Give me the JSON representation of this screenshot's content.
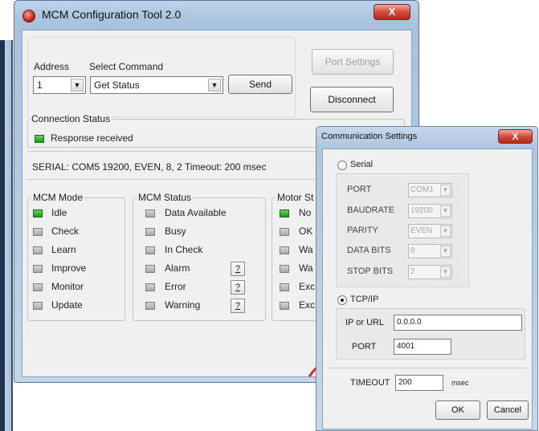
{
  "window": {
    "title": "MCM Configuration Tool 2.0",
    "close_label": "X"
  },
  "top": {
    "address_label": "Address",
    "select_command_label": "Select Command",
    "address_value": "1",
    "command_value": "Get Status",
    "send_label": "Send",
    "port_settings_label": "Port Settings",
    "disconnect_label": "Disconnect"
  },
  "connection": {
    "group_title": "Connection Status",
    "response_text": "Response received",
    "serial_info": "SERIAL: COM5  19200, EVEN, 8, 2 Timeout: 200 msec"
  },
  "mcm_mode": {
    "title": "MCM Mode",
    "items": [
      {
        "label": "Idle",
        "on": true
      },
      {
        "label": "Check",
        "on": false
      },
      {
        "label": "Learn",
        "on": false
      },
      {
        "label": "Improve",
        "on": false
      },
      {
        "label": "Monitor",
        "on": false
      },
      {
        "label": "Update",
        "on": false
      }
    ]
  },
  "mcm_status": {
    "title": "MCM Status",
    "items": [
      {
        "label": "Data Available"
      },
      {
        "label": "Busy"
      },
      {
        "label": "In Check"
      },
      {
        "label": "Alarm",
        "help": "?"
      },
      {
        "label": "Error",
        "help": "?"
      },
      {
        "label": "Warning",
        "help": "?"
      }
    ]
  },
  "motor_status": {
    "title": "Motor St",
    "items": [
      {
        "label": "No",
        "on": true
      },
      {
        "label": "OK",
        "on": false
      },
      {
        "label": "Wa",
        "on": false
      },
      {
        "label": "Wa",
        "on": false
      },
      {
        "label": "Exc",
        "on": false
      },
      {
        "label": "Exc",
        "on": false
      }
    ]
  },
  "dialog": {
    "title": "Communication Settings",
    "close_label": "X",
    "serial_label": "Serial",
    "port_label": "PORT",
    "port_value": "COM1",
    "baud_label": "BAUDRATE",
    "baud_value": "19200",
    "parity_label": "PARITY",
    "parity_value": "EVEN",
    "databits_label": "DATA BITS",
    "databits_value": "8",
    "stopbits_label": "STOP BITS",
    "stopbits_value": "2",
    "tcpip_label": "TCP/IP",
    "ip_label": "IP or URL",
    "ip_value": "0.0.0.0",
    "tcp_port_label": "PORT",
    "tcp_port_value": "4001",
    "timeout_label": "TIMEOUT",
    "timeout_value": "200",
    "timeout_unit": "msec",
    "ok_label": "OK",
    "cancel_label": "Cancel"
  },
  "colors": {
    "led_on": "#1f9a1a",
    "titlebar": "#a7c2de",
    "close": "#d64a39"
  }
}
